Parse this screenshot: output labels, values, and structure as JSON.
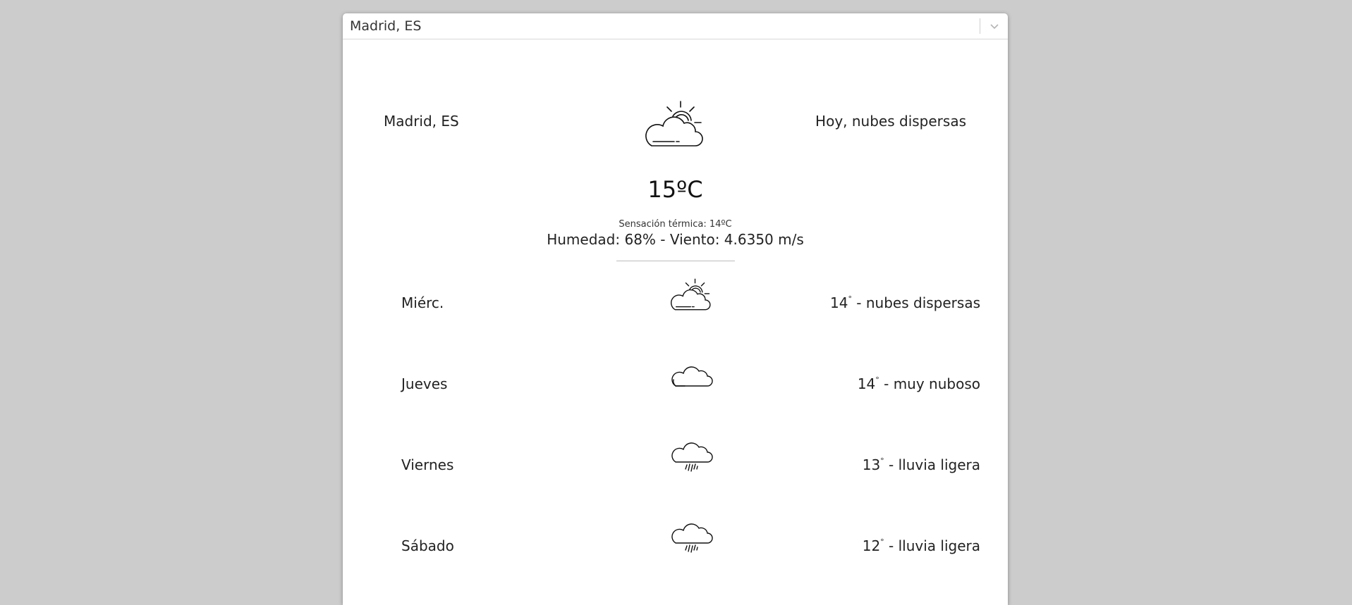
{
  "city_select": {
    "value": "Madrid, ES"
  },
  "current": {
    "city": "Madrid, ES",
    "description": "Hoy, nubes dispersas",
    "icon": "scattered-clouds-icon",
    "temperature": "15ºC",
    "feels_like": "Sensación térmica: 14ºC",
    "details": "Humedad: 68% - Viento: 4.6350 m/s"
  },
  "forecast": [
    {
      "day": "Miérc.",
      "temp": "14",
      "deg": "°",
      "desc": " - nubes dispersas",
      "icon": "scattered-clouds-icon"
    },
    {
      "day": "Jueves",
      "temp": "14",
      "deg": "°",
      "desc": " - muy nuboso",
      "icon": "cloud-icon"
    },
    {
      "day": "Viernes",
      "temp": "13",
      "deg": "°",
      "desc": " - lluvia ligera",
      "icon": "light-rain-icon"
    },
    {
      "day": "Sábado",
      "temp": "12",
      "deg": "°",
      "desc": " - lluvia ligera",
      "icon": "light-rain-icon"
    }
  ]
}
